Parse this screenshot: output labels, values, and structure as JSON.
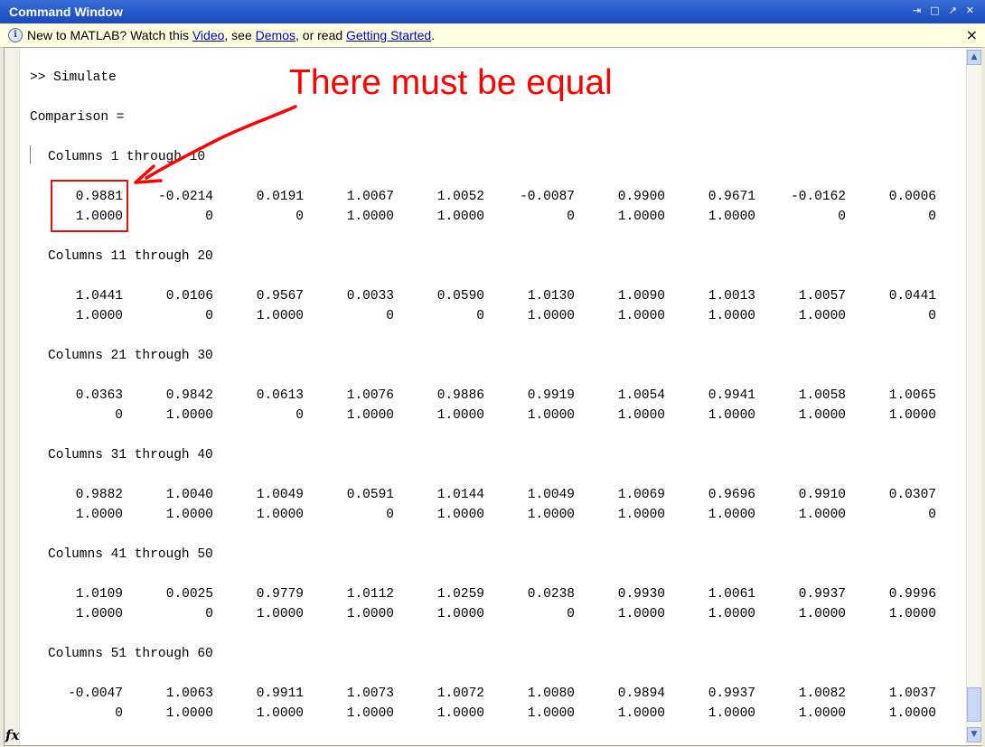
{
  "window": {
    "title": "Command Window",
    "controls": [
      "⇥",
      "□",
      "↗",
      "✕"
    ]
  },
  "infobar": {
    "prefix": "New to MATLAB? Watch this ",
    "link_video": "Video",
    "sep1": ", see ",
    "link_demos": "Demos",
    "sep2": ", or read ",
    "link_getting_started": "Getting Started",
    "suffix": ".",
    "close": "×"
  },
  "console": {
    "prompt": ">> Simulate",
    "var_name": "Comparison =",
    "blocks": [
      {
        "header": "Columns 1 through 10",
        "row1": [
          "0.9881",
          "-0.0214",
          "0.0191",
          "1.0067",
          "1.0052",
          "-0.0087",
          "0.9900",
          "0.9671",
          "-0.0162",
          "0.0006"
        ],
        "row2": [
          "1.0000",
          "0",
          "0",
          "1.0000",
          "1.0000",
          "0",
          "1.0000",
          "1.0000",
          "0",
          "0"
        ]
      },
      {
        "header": "Columns 11 through 20",
        "row1": [
          "1.0441",
          "0.0106",
          "0.9567",
          "0.0033",
          "0.0590",
          "1.0130",
          "1.0090",
          "1.0013",
          "1.0057",
          "0.0441"
        ],
        "row2": [
          "1.0000",
          "0",
          "1.0000",
          "0",
          "0",
          "1.0000",
          "1.0000",
          "1.0000",
          "1.0000",
          "0"
        ]
      },
      {
        "header": "Columns 21 through 30",
        "row1": [
          "0.0363",
          "0.9842",
          "0.0613",
          "1.0076",
          "0.9886",
          "0.9919",
          "1.0054",
          "0.9941",
          "1.0058",
          "1.0065"
        ],
        "row2": [
          "0",
          "1.0000",
          "0",
          "1.0000",
          "1.0000",
          "1.0000",
          "1.0000",
          "1.0000",
          "1.0000",
          "1.0000"
        ]
      },
      {
        "header": "Columns 31 through 40",
        "row1": [
          "0.9882",
          "1.0040",
          "1.0049",
          "0.0591",
          "1.0144",
          "1.0049",
          "1.0069",
          "0.9696",
          "0.9910",
          "0.0307"
        ],
        "row2": [
          "1.0000",
          "1.0000",
          "1.0000",
          "0",
          "1.0000",
          "1.0000",
          "1.0000",
          "1.0000",
          "1.0000",
          "0"
        ]
      },
      {
        "header": "Columns 41 through 50",
        "row1": [
          "1.0109",
          "0.0025",
          "0.9779",
          "1.0112",
          "1.0259",
          "0.0238",
          "0.9930",
          "1.0061",
          "0.9937",
          "0.9996"
        ],
        "row2": [
          "1.0000",
          "0",
          "1.0000",
          "1.0000",
          "1.0000",
          "0",
          "1.0000",
          "1.0000",
          "1.0000",
          "1.0000"
        ]
      },
      {
        "header": "Columns 51 through 60",
        "row1": [
          "-0.0047",
          "1.0063",
          "0.9911",
          "1.0073",
          "1.0072",
          "1.0080",
          "0.9894",
          "0.9937",
          "1.0082",
          "1.0037"
        ],
        "row2": [
          "0",
          "1.0000",
          "1.0000",
          "1.0000",
          "1.0000",
          "1.0000",
          "1.0000",
          "1.0000",
          "1.0000",
          "1.0000"
        ]
      }
    ]
  },
  "annotation": {
    "text": "There must be equal",
    "color": "#ff0000"
  },
  "fx_label": "fx",
  "scroll": {
    "up": "▲",
    "down": "▼"
  }
}
